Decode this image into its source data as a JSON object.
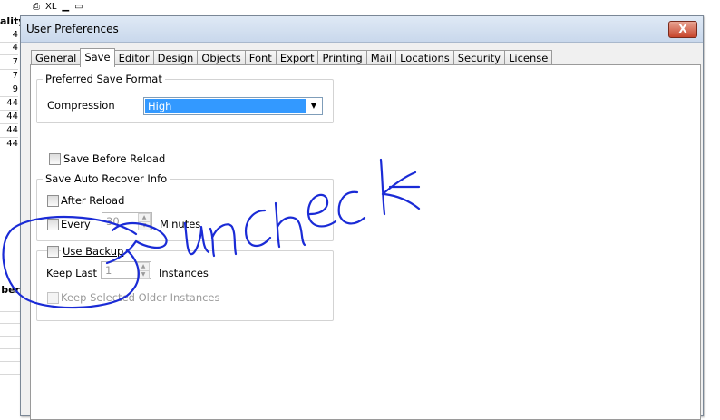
{
  "background": {
    "col1_header": "ality",
    "col1_values": [
      "4",
      "4",
      "7",
      "7",
      "9",
      "44",
      "44",
      "44",
      "44"
    ],
    "col2_header": "ber",
    "toolbar": {
      "xl_label": "XL"
    }
  },
  "dialog": {
    "title": "User Preferences",
    "close_label": "X",
    "tabs": [
      "General",
      "Save",
      "Editor",
      "Design",
      "Objects",
      "Font",
      "Export",
      "Printing",
      "Mail",
      "Locations",
      "Security",
      "License"
    ],
    "active_tab": "Save"
  },
  "save_tab": {
    "preferred_format": {
      "group_label": "Preferred Save Format",
      "compression_label": "Compression",
      "compression_value": "High"
    },
    "save_before_reload": {
      "label": "Save Before Reload",
      "checked": false
    },
    "auto_recover": {
      "group_label": "Save Auto Recover Info",
      "after_reload_label": "After Reload",
      "every_label": "Every",
      "every_value": "30",
      "minutes_label": "Minutes"
    },
    "backup": {
      "use_backup_label": "Use Backup",
      "keep_last_label": "Keep Last",
      "keep_last_value": "1",
      "instances_label": "Instances",
      "keep_selected_label": "Keep Selected Older Instances"
    }
  },
  "annotation": {
    "text": "uncheck",
    "color": "#1a2bd6"
  }
}
